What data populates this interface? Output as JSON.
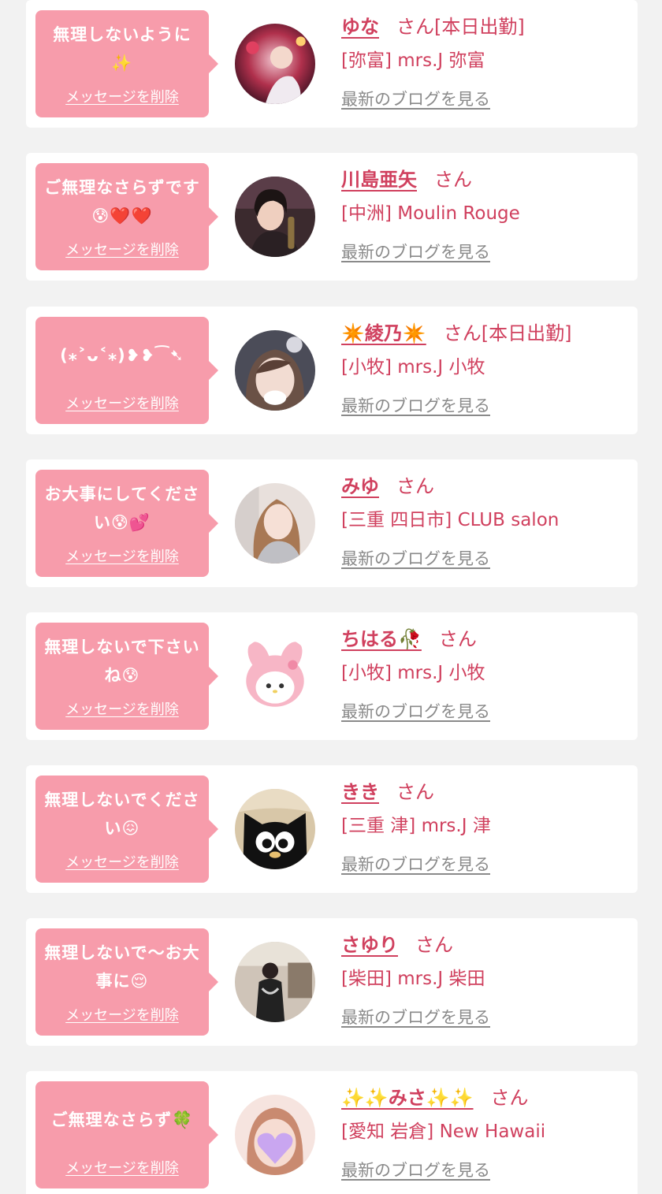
{
  "delete_label": "メッセージを削除",
  "blog_label": "最新のブログを見る",
  "colors": {
    "background": "#f2f2f2",
    "card": "#ffffff",
    "bubble": "#f79cab",
    "accent": "#d0405e",
    "link_gray": "#8a8a8a"
  },
  "messages": [
    {
      "message": "無理しないように✨",
      "name": "ゆな",
      "honorific": "さん[本日出勤]",
      "shop": "[弥富] mrs.J 弥富",
      "avatar_icon": "photo-avatar-icon"
    },
    {
      "message": "ご無理なさらずです😰❤️❤️",
      "name": "川島亜矢",
      "honorific": "さん",
      "shop": "[中洲] Moulin Rouge",
      "avatar_icon": "photo-avatar-icon"
    },
    {
      "message": "(⁎˃ᴗ˂⁎)❥❥⁀➷",
      "name": "✴️綾乃✴️",
      "honorific": "さん[本日出勤]",
      "shop": "[小牧] mrs.J 小牧",
      "avatar_icon": "photo-avatar-icon"
    },
    {
      "message": "お大事にしてください😰💕",
      "name": "みゆ",
      "honorific": "さん",
      "shop": "[三重 四日市] CLUB salon",
      "avatar_icon": "photo-avatar-icon"
    },
    {
      "message": "無理しないで下さいね😰",
      "name": "ちはる🥀",
      "honorific": "さん",
      "shop": "[小牧] mrs.J 小牧",
      "avatar_icon": "my-melody-avatar-icon"
    },
    {
      "message": "無理しないでください😖",
      "name": "きき",
      "honorific": "さん",
      "shop": "[三重 津] mrs.J 津",
      "avatar_icon": "black-cat-avatar-icon"
    },
    {
      "message": "無理しないで〜お大事に😌",
      "name": "さゆり",
      "honorific": "さん",
      "shop": "[柴田] mrs.J 柴田",
      "avatar_icon": "photo-avatar-icon"
    },
    {
      "message": "ご無理なさらず🍀",
      "name": "✨✨みさ✨✨",
      "honorific": "さん",
      "shop": "[愛知 岩倉] New Hawaii",
      "avatar_icon": "heart-blur-avatar-icon"
    }
  ]
}
